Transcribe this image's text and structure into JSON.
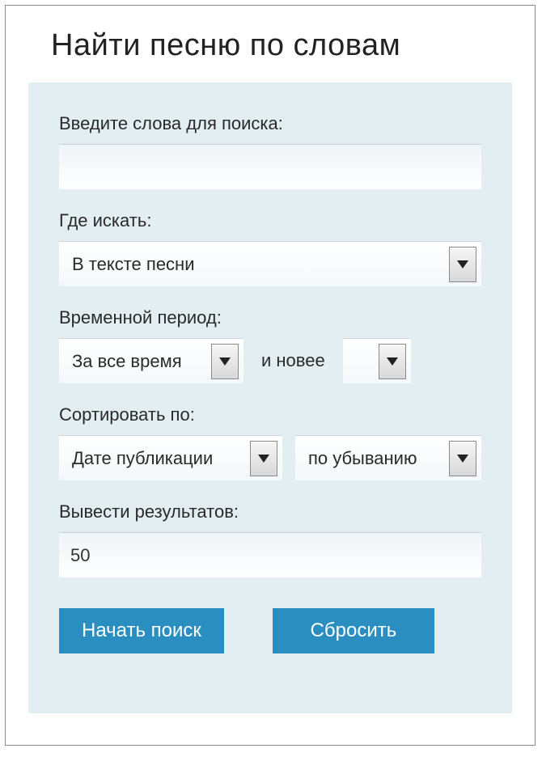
{
  "title": "Найти песню по словам",
  "form": {
    "search_words": {
      "label": "Введите слова для поиска:",
      "value": ""
    },
    "search_in": {
      "label": "Где искать:",
      "value": "В тексте песни"
    },
    "time_period": {
      "label": "Временной период:",
      "value": "За все время",
      "conjunction": "и новее",
      "value2": ""
    },
    "sort_by": {
      "label": "Сортировать по:",
      "value": "Дате публикации",
      "direction": "по убыванию"
    },
    "results_count": {
      "label": "Вывести результатов:",
      "value": "50"
    }
  },
  "buttons": {
    "search": "Начать поиск",
    "reset": "Сбросить"
  }
}
